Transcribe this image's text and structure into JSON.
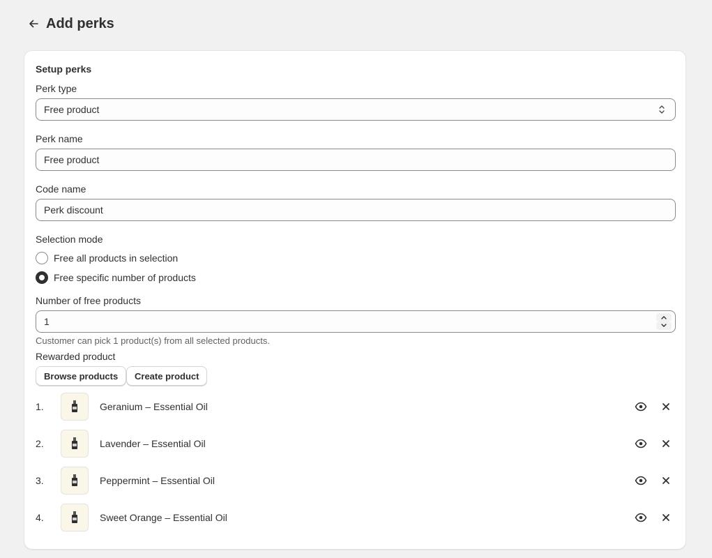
{
  "header": {
    "title": "Add perks"
  },
  "card": {
    "section_title": "Setup perks",
    "perk_type": {
      "label": "Perk type",
      "value": "Free product"
    },
    "perk_name": {
      "label": "Perk name",
      "value": "Free product"
    },
    "code_name": {
      "label": "Code name",
      "value": "Perk discount"
    },
    "selection_mode": {
      "label": "Selection mode",
      "options": [
        {
          "label": "Free all products in selection",
          "checked": false
        },
        {
          "label": "Free specific number of products",
          "checked": true
        }
      ]
    },
    "free_products": {
      "label": "Number of free products",
      "value": "1",
      "help": "Customer can pick 1 product(s) from all selected products."
    },
    "rewarded": {
      "label": "Rewarded product",
      "browse_label": "Browse products",
      "create_label": "Create product",
      "items": [
        {
          "num": "1.",
          "name": "Geranium – Essential Oil"
        },
        {
          "num": "2.",
          "name": "Lavender – Essential Oil"
        },
        {
          "num": "3.",
          "name": "Peppermint – Essential Oil"
        },
        {
          "num": "4.",
          "name": "Sweet Orange – Essential Oil"
        }
      ]
    }
  },
  "icons": {
    "back": "arrow-left-icon",
    "select": "select-chevron-icon",
    "view": "eye-icon",
    "remove": "close-icon"
  }
}
